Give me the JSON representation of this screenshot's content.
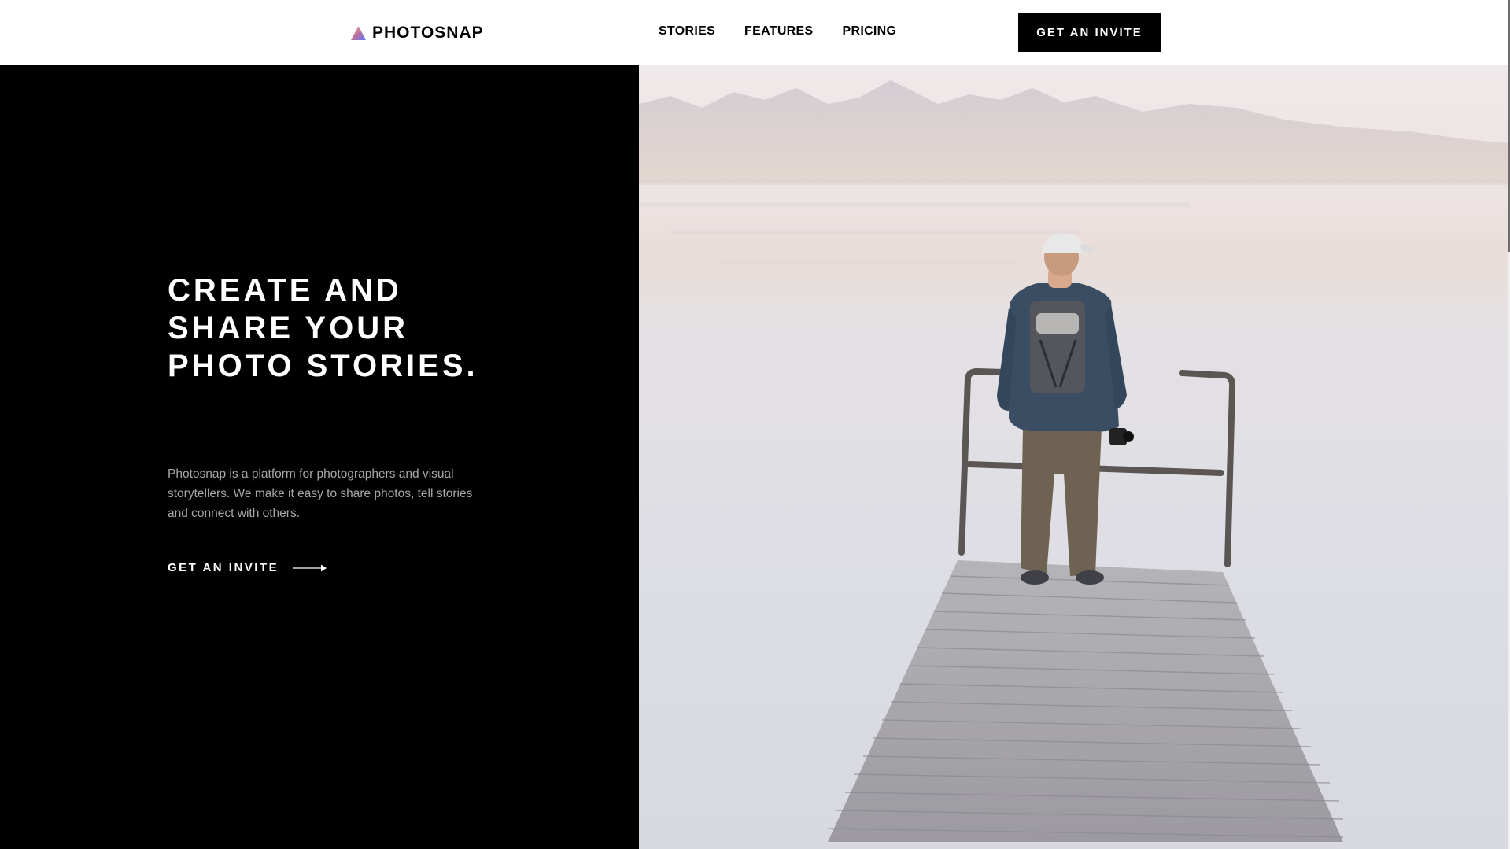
{
  "header": {
    "logo_text": "PHOTOSNAP",
    "logo_icon": "triangle-logo-icon",
    "nav": [
      {
        "label": "STORIES"
      },
      {
        "label": "FEATURES"
      },
      {
        "label": "PRICING"
      }
    ],
    "cta_label": "GET AN INVITE"
  },
  "hero": {
    "title_lines": [
      "CREATE AND",
      "SHARE YOUR",
      "PHOTO STORIES."
    ],
    "description": "Photosnap is a platform for photographers and visual storytellers. We make it easy to share photos, tell stories and connect with others.",
    "link_label": "GET AN INVITE",
    "link_icon": "arrow-right-icon",
    "image_subject": "photographer-on-pier"
  },
  "colors": {
    "accent_gradient": [
      "#FFC593",
      "#BC7198",
      "#5A77FF"
    ],
    "background_dark": "#000000",
    "text_muted": "#a8a8a8"
  }
}
